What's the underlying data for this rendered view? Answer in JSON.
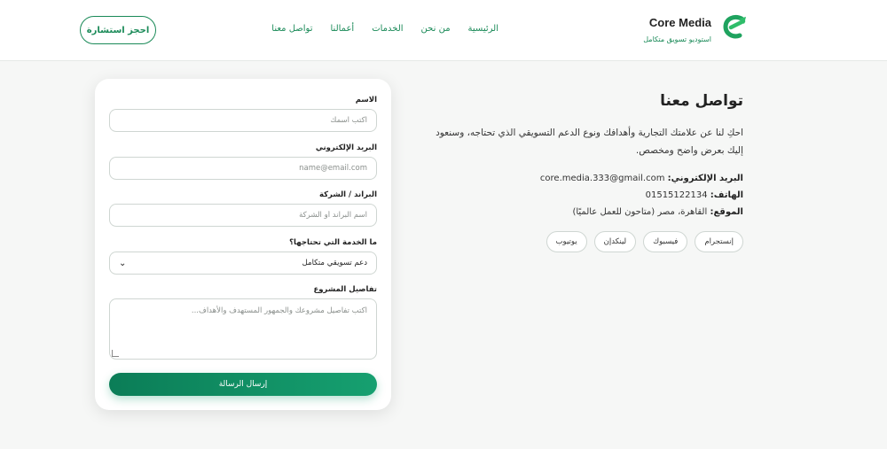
{
  "header": {
    "brand_name": "Core Media",
    "brand_tagline": "استوديو تسويق متكامل",
    "logo_icon": "core-media-logo-icon",
    "nav": [
      "الرئيسية",
      "من نحن",
      "الخدمات",
      "أعمالنا",
      "تواصل معنا"
    ],
    "cta_label": "احجز استشارة",
    "accent_color": "#1a8a58"
  },
  "contact": {
    "title": "تواصل معنا",
    "description": "احكِ لنا عن علامتك التجارية وأهدافك ونوع الدعم التسويقي الذي تحتاجه، وسنعود إليك بعرض واضح ومخصص.",
    "email_label": "البريد الإلكتروني:",
    "email_value": "core.media.333@gmail.com",
    "phone_label": "الهاتف:",
    "phone_value": "01515122134",
    "location_label": "الموقع:",
    "location_value": "القاهرة، مصر (متاحون للعمل عالميًا)",
    "socials": [
      "إنستجرام",
      "فيسبوك",
      "لينكدإن",
      "يوتيوب"
    ]
  },
  "form": {
    "name_label": "الاسم",
    "name_placeholder": "اكتب اسمك",
    "email_label": "البريد الإلكتروني",
    "email_placeholder": "name@email.com",
    "brand_label": "البراند / الشركة",
    "brand_placeholder": "اسم البراند أو الشركة",
    "service_label": "ما الخدمة التي تحتاجها؟",
    "service_value": "دعم تسويقي متكامل",
    "details_label": "تفاصيل المشروع",
    "details_placeholder": "اكتب تفاصيل مشروعك والجمهور المستهدف والأهداف...",
    "submit_label": "إرسال الرسالة",
    "button_color": "#0b7d57"
  }
}
